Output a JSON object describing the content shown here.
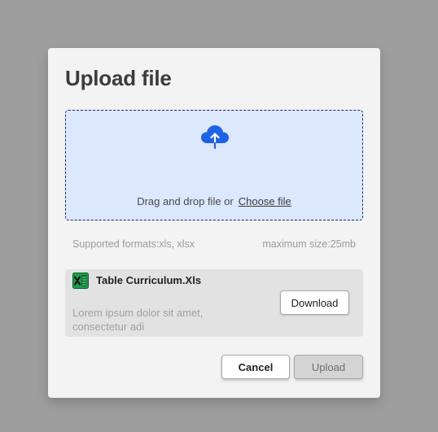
{
  "dialog": {
    "title": "Upload file"
  },
  "dropzone": {
    "icon": "cloud-upload-icon",
    "accent_color": "#1e63e6",
    "background_color": "#dbe8fd",
    "prompt_text": "Drag and drop file or",
    "choose_link": "Choose file"
  },
  "constraints": {
    "formats": "Supported formats:xls, xlsx",
    "max_size": "maximum size:25mb"
  },
  "file": {
    "icon": "excel-file-icon",
    "icon_color": "#1f9d4f",
    "name": "Table Curriculum.Xls",
    "description": "Lorem ipsum dolor sit amet, consectetur adi",
    "download_label": "Download"
  },
  "footer": {
    "cancel_label": "Cancel",
    "upload_label": "Upload"
  }
}
